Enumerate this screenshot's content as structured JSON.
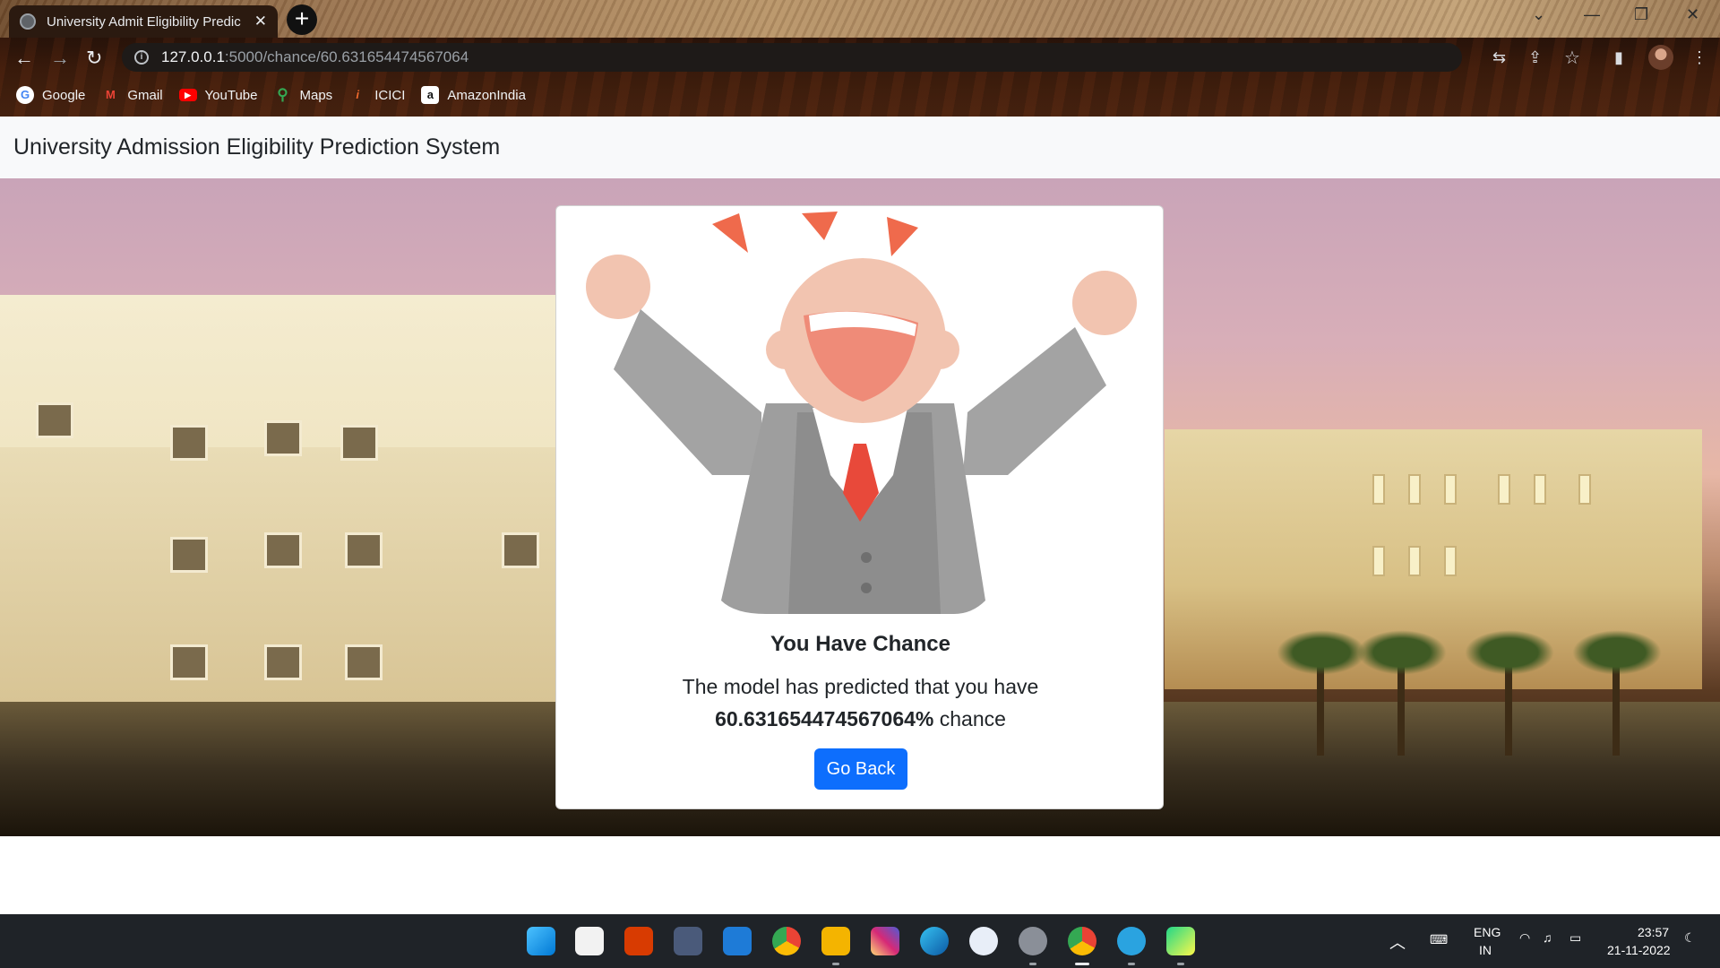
{
  "browser": {
    "tab_title": "University Admit Eligibility Predic",
    "tab_close": "✕",
    "new_tab": "+",
    "url_host": "127.0.0.1",
    "url_path": ":5000/chance/60.631654474567064",
    "bookmarks": [
      {
        "label": "Google",
        "icon": "google-icon",
        "color": "#4285f4"
      },
      {
        "label": "Gmail",
        "icon": "gmail-icon",
        "color": "#ea4335"
      },
      {
        "label": "YouTube",
        "icon": "youtube-icon",
        "color": "#ff0000"
      },
      {
        "label": "Maps",
        "icon": "maps-icon",
        "color": "#34a853"
      },
      {
        "label": "ICICI",
        "icon": "icici-icon",
        "color": "#f06a2d"
      },
      {
        "label": "AmazonIndia",
        "icon": "amazon-icon",
        "color": "#ffffff"
      }
    ]
  },
  "page": {
    "brand": "University Admission Eligibility Prediction System",
    "card_title": "You Have Chance",
    "message": "The model has predicted that you have",
    "chance_value": "60.631654474567064%",
    "chance_suffix": " chance",
    "button_label": "Go Back"
  },
  "taskbar": {
    "lang_line1": "ENG",
    "lang_line2": "IN",
    "time": "23:57",
    "date": "21-11-2022"
  },
  "colors": {
    "primary_button": "#0d6efd",
    "navbar_bg": "#f8f9fa",
    "suit_gray": "#9e9e9e",
    "skin": "#f2c4b0",
    "tie_red": "#e8493a",
    "accent_orange": "#ef6a4c"
  }
}
